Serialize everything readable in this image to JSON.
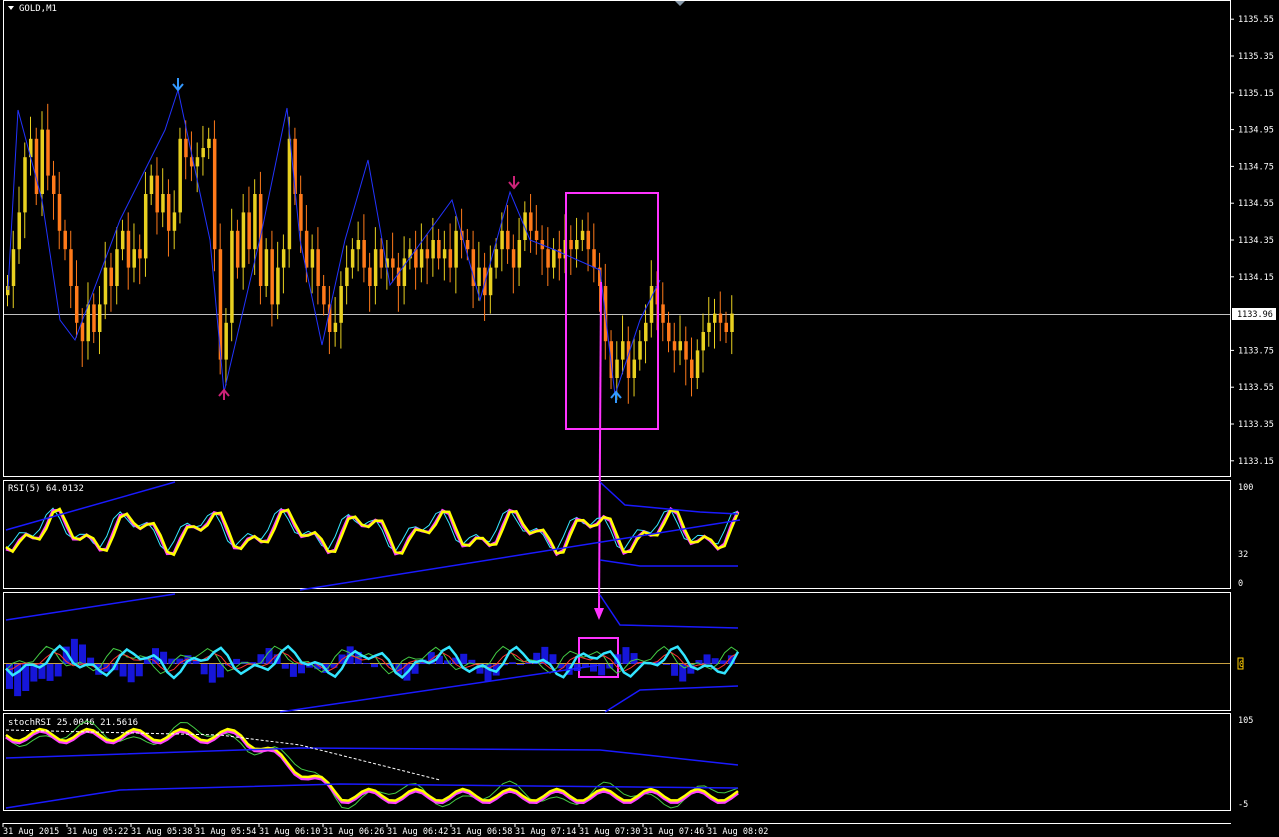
{
  "window": {
    "title": "GOLD,M1"
  },
  "price_axis": {
    "labels": [
      "1135.55",
      "1135.35",
      "1135.15",
      "1134.95",
      "1134.75",
      "1134.55",
      "1134.35",
      "1134.15",
      "1133.75",
      "1133.55",
      "1133.35",
      "1133.15"
    ],
    "current_price": "1133.96"
  },
  "rsi_panel": {
    "title": "RSI(5) 64.0132",
    "levels": [
      "100",
      "32",
      "0"
    ]
  },
  "macd_panel": {
    "marker": "0"
  },
  "stoch_panel": {
    "title": "stochRSI 25.0046 21.5616",
    "levels": [
      "105",
      "-5"
    ]
  },
  "time_axis": {
    "labels": [
      "31 Aug 2015",
      "31 Aug 05:22",
      "31 Aug 05:38",
      "31 Aug 05:54",
      "31 Aug 06:10",
      "31 Aug 06:26",
      "31 Aug 06:42",
      "31 Aug 06:58",
      "31 Aug 07:14",
      "31 Aug 07:30",
      "31 Aug 07:46",
      "31 Aug 08:02"
    ]
  },
  "colors": {
    "bull": "#e8d020",
    "bear": "#ff7a1a",
    "zigzag": "#2233ff",
    "annot": "#ff33ff",
    "rsi_main": "#ffff00",
    "rsi_sig": "#ff44ff",
    "cyan": "#33e5ff",
    "band": "#1a1aff",
    "green": "#44cc44",
    "red": "#ff3333",
    "grid": "#ffffff",
    "zero": "#c8a040"
  },
  "chart_data": {
    "type": "candlestick",
    "title": "GOLD,M1",
    "ylim": [
      1133.1,
      1135.6
    ],
    "closes": [
      1134.1,
      1134.3,
      1134.5,
      1134.8,
      1134.9,
      1134.6,
      1134.95,
      1134.7,
      1134.6,
      1134.4,
      1134.3,
      1134.1,
      1133.9,
      1133.8,
      1134.0,
      1133.85,
      1134.0,
      1134.2,
      1134.1,
      1134.3,
      1134.4,
      1134.2,
      1134.3,
      1134.25,
      1134.6,
      1134.7,
      1134.5,
      1134.6,
      1134.4,
      1134.5,
      1134.9,
      1134.8,
      1134.75,
      1134.8,
      1134.85,
      1134.9,
      1134.3,
      1133.7,
      1133.9,
      1134.4,
      1134.2,
      1134.5,
      1134.3,
      1134.6,
      1134.1,
      1134.3,
      1134.0,
      1134.2,
      1134.3,
      1134.9,
      1134.6,
      1134.4,
      1134.2,
      1134.3,
      1134.1,
      1134.0,
      1133.85,
      1133.9,
      1134.1,
      1134.2,
      1134.3,
      1134.35,
      1134.2,
      1134.1,
      1134.3,
      1134.2,
      1134.25,
      1134.2,
      1134.1,
      1134.25,
      1134.3,
      1134.2,
      1134.3,
      1134.25,
      1134.35,
      1134.25,
      1134.3,
      1134.2,
      1134.4,
      1134.35,
      1134.3,
      1134.1,
      1134.2,
      1134.05,
      1134.2,
      1134.3,
      1134.4,
      1134.3,
      1134.2,
      1134.35,
      1134.5,
      1134.4,
      1134.35,
      1134.3,
      1134.2,
      1134.3,
      1134.25,
      1134.35,
      1134.3,
      1134.35,
      1134.4,
      1134.3,
      1134.2,
      1134.1,
      1133.8,
      1133.6,
      1133.7,
      1133.8,
      1133.6,
      1133.7,
      1133.8,
      1133.9,
      1134.1,
      1134.0,
      1133.9,
      1133.8,
      1133.75,
      1133.8,
      1133.7,
      1133.6,
      1133.75,
      1133.85,
      1133.9,
      1133.95,
      1133.9,
      1133.85,
      1133.95
    ],
    "series": [
      {
        "name": "RSI(5)",
        "last": 64.0132
      },
      {
        "name": "stochRSI",
        "values_last": [
          25.0046,
          21.5616
        ]
      }
    ]
  }
}
